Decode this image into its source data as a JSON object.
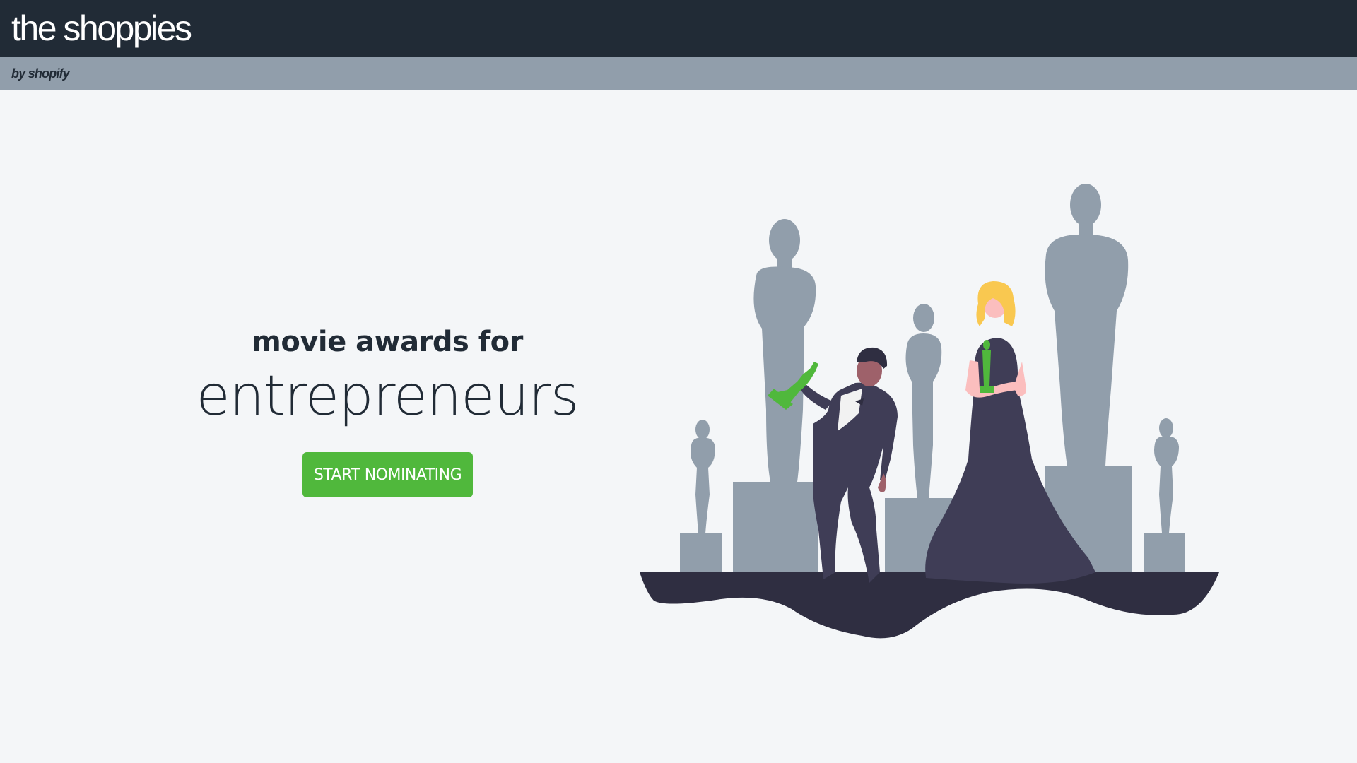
{
  "header": {
    "brand": "the shoppies",
    "byline": "by shopify"
  },
  "hero": {
    "line1": "movie awards for",
    "line2": "entrepreneurs",
    "cta_label": "START NOMINATING"
  },
  "colors": {
    "header_bg": "#212b36",
    "subheader_bg": "#919eab",
    "page_bg": "#f4f6f8",
    "accent_green": "#50b83c",
    "statue_gray": "#919eab",
    "suit": "#3f3d56",
    "ground": "#2f2e41"
  },
  "illustration": {
    "icon": "award-ceremony-illustration"
  }
}
